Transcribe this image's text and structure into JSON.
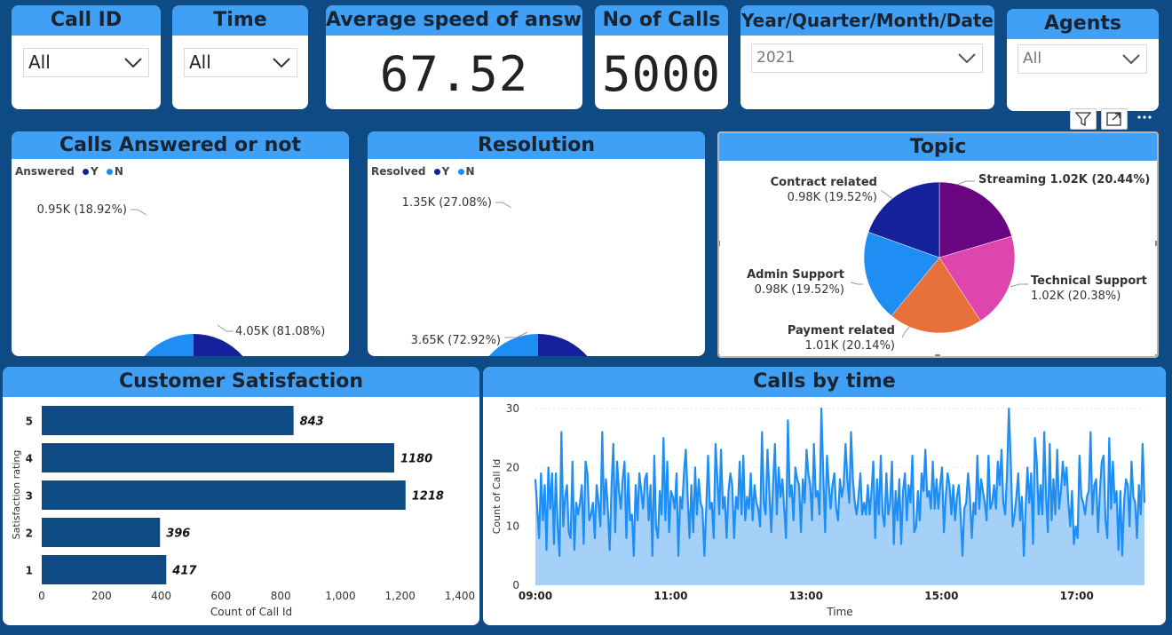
{
  "slicers": {
    "call_id": {
      "title": "Call ID",
      "value": "All"
    },
    "time": {
      "title": "Time",
      "value": "All"
    },
    "date": {
      "title": "Year/Quarter/Month/Date",
      "value": "2021"
    },
    "agents": {
      "title": "Agents",
      "value": "All"
    }
  },
  "kpis": {
    "asa": {
      "title": "Average speed of answer",
      "value": "67.52"
    },
    "calls": {
      "title": "No of Calls",
      "value": "5000"
    }
  },
  "colors": {
    "background": "#0e4a84",
    "header": "#3fa0f5",
    "dark_blue": "#14219a",
    "light_blue": "#1e8ef5",
    "bar": "#0e4a84",
    "line": "#1e8ef5",
    "area": "#a5d0f8"
  },
  "chart_data": [
    {
      "type": "pie",
      "title": "Calls Answered or not",
      "legend_title": "Answered",
      "categories": [
        "Y",
        "N"
      ],
      "values": [
        4050,
        950
      ],
      "labels": [
        "4.05K (81.08%)",
        "0.95K (18.92%)"
      ],
      "colors": [
        "#14219a",
        "#1e8ef5"
      ]
    },
    {
      "type": "pie",
      "title": "Resolution",
      "legend_title": "Resolved",
      "categories": [
        "Y",
        "N"
      ],
      "values": [
        3650,
        1350
      ],
      "labels": [
        "3.65K (72.92%)",
        "1.35K (27.08%)"
      ],
      "colors": [
        "#14219a",
        "#1e8ef5"
      ]
    },
    {
      "type": "pie",
      "title": "Topic",
      "categories": [
        "Streaming",
        "Technical Support",
        "Payment related",
        "Admin Support",
        "Contract related"
      ],
      "values": [
        1020,
        1020,
        1010,
        980,
        980
      ],
      "percent": [
        20.44,
        20.38,
        20.14,
        19.52,
        19.52
      ],
      "labels": [
        [
          "Streaming 1.02K (20.44%)"
        ],
        [
          "Technical Support",
          "1.02K (20.38%)"
        ],
        [
          "Payment related",
          "1.01K (20.14%)"
        ],
        [
          "Admin Support",
          "0.98K (19.52%)"
        ],
        [
          "Contract related",
          "0.98K (19.52%)"
        ]
      ],
      "colors": [
        "#6a0582",
        "#de45ad",
        "#e8703a",
        "#1e8ef5",
        "#14219a"
      ]
    },
    {
      "type": "bar",
      "title": "Customer Satisfaction",
      "orientation": "horizontal",
      "categories": [
        "5",
        "4",
        "3",
        "2",
        "1"
      ],
      "values": [
        843,
        1180,
        1218,
        396,
        417
      ],
      "value_labels": [
        "843",
        "1180",
        "1218",
        "396",
        "417"
      ],
      "xlabel": "Count of Call Id",
      "ylabel": "Satisfaction rating",
      "xlim": [
        0,
        1400
      ],
      "xticks": [
        "0",
        "200",
        "400",
        "600",
        "800",
        "1,000",
        "1,200",
        "1,400"
      ]
    },
    {
      "type": "area",
      "title": "Calls by time",
      "xlabel": "Time",
      "ylabel": "Count of Call Id",
      "ylim": [
        0,
        30
      ],
      "yticks": [
        "0",
        "10",
        "20",
        "30"
      ],
      "xticks": [
        "09:00",
        "11:00",
        "13:00",
        "15:00",
        "17:00"
      ],
      "x_start": "09:00",
      "x_end": "18:00",
      "values": [
        18,
        13,
        8,
        19,
        11,
        17,
        6,
        20,
        13,
        19,
        7,
        19,
        10,
        5,
        26,
        10,
        15,
        17,
        9,
        8,
        21,
        6,
        14,
        12,
        14,
        17,
        7,
        21,
        19,
        11,
        12,
        14,
        8,
        17,
        14,
        10,
        26,
        12,
        18,
        13,
        6,
        17,
        24,
        9,
        21,
        16,
        13,
        18,
        21,
        8,
        19,
        11,
        12,
        5,
        17,
        11,
        19,
        16,
        13,
        18,
        19,
        11,
        17,
        5,
        22,
        10,
        8,
        16,
        12,
        25,
        11,
        21,
        9,
        16,
        15,
        13,
        19,
        5,
        15,
        13,
        19,
        23,
        15,
        8,
        17,
        9,
        20,
        12,
        18,
        14,
        13,
        5,
        13,
        22,
        13,
        14,
        8,
        24,
        18,
        12,
        23,
        13,
        15,
        8,
        16,
        19,
        17,
        8,
        15,
        13,
        21,
        12,
        22,
        11,
        15,
        13,
        19,
        11,
        17,
        14,
        13,
        10,
        26,
        14,
        12,
        23,
        16,
        9,
        17,
        24,
        12,
        20,
        15,
        18,
        13,
        8,
        28,
        15,
        17,
        11,
        20,
        18,
        17,
        9,
        18,
        14,
        23,
        19,
        17,
        11,
        24,
        15,
        16,
        12,
        30,
        19,
        9,
        22,
        17,
        13,
        17,
        19,
        13,
        11,
        18,
        15,
        17,
        24,
        18,
        14,
        26,
        18,
        14,
        12,
        15,
        19,
        12,
        14,
        12,
        17,
        12,
        16,
        21,
        8,
        18,
        12,
        22,
        12,
        10,
        19,
        12,
        14,
        21,
        7,
        16,
        11,
        18,
        7,
        16,
        19,
        11,
        17,
        14,
        22,
        9,
        10,
        16,
        11,
        19,
        16,
        23,
        15,
        16,
        13,
        21,
        13,
        18,
        13,
        17,
        20,
        9,
        15,
        19,
        17,
        12,
        17,
        11,
        15,
        17,
        12,
        5,
        13,
        14,
        19,
        15,
        8,
        14,
        12,
        22,
        13,
        18,
        16,
        14,
        11,
        22,
        13,
        14,
        17,
        13,
        21,
        17,
        23,
        14,
        12,
        19,
        30,
        21,
        10,
        12,
        15,
        19,
        11,
        15,
        5,
        13,
        20,
        14,
        19,
        7,
        25,
        21,
        12,
        17,
        12,
        26,
        15,
        9,
        24,
        11,
        18,
        12,
        23,
        13,
        16,
        21,
        17,
        20,
        14,
        10,
        16,
        7,
        10,
        8,
        22,
        15,
        14,
        12,
        15,
        16,
        26,
        12,
        17,
        18,
        9,
        16,
        21,
        22,
        11,
        8,
        25,
        13,
        21,
        14,
        16,
        6,
        16,
        5,
        14,
        18,
        17,
        10,
        21,
        15,
        14,
        8,
        17,
        12,
        24,
        14
      ]
    }
  ]
}
